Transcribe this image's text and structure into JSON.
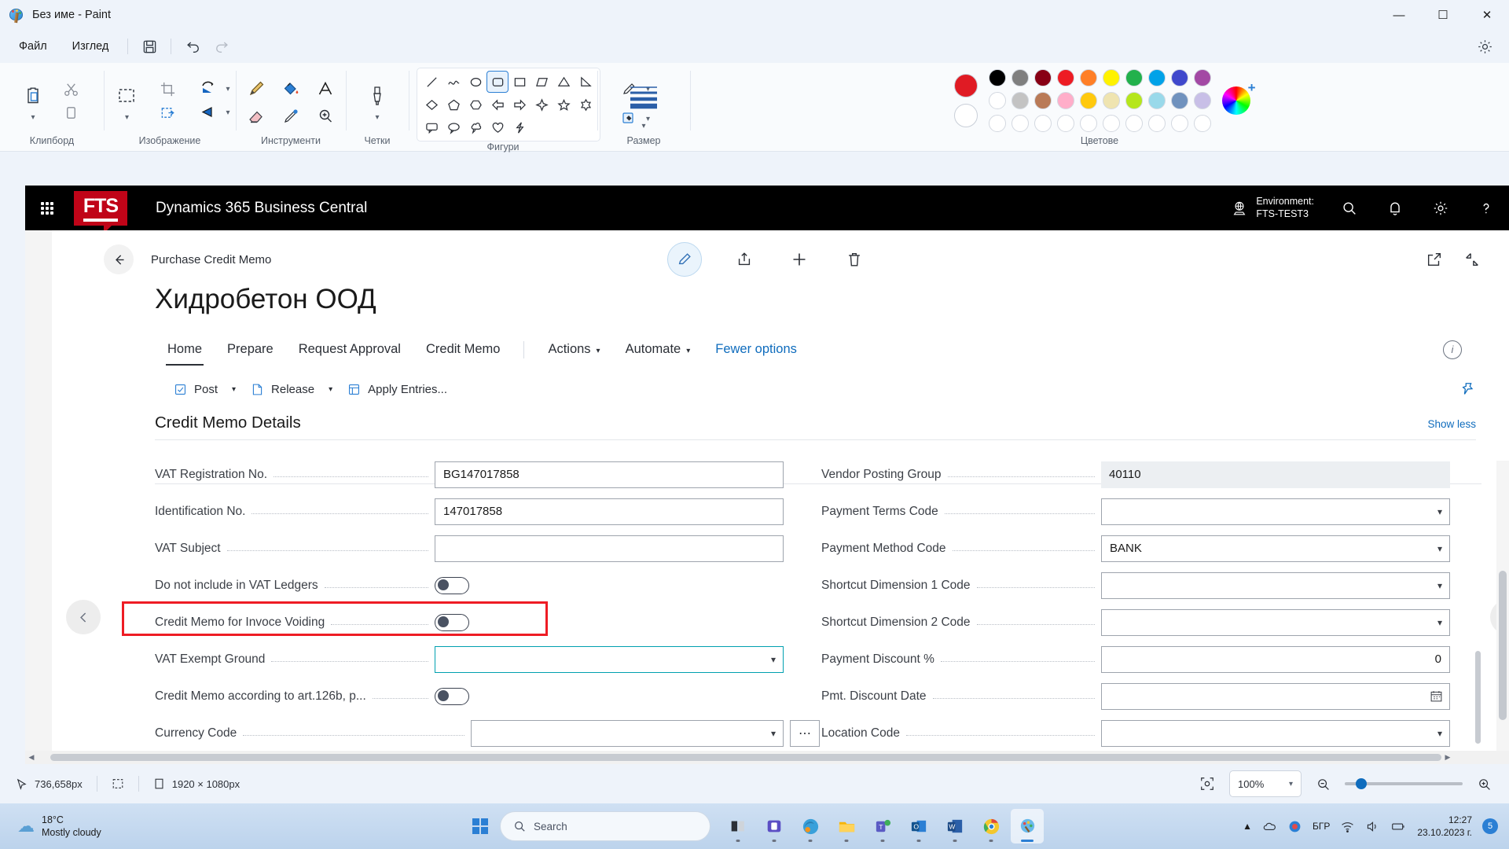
{
  "paint": {
    "title": "Без име - Paint",
    "menus": [
      "Файл",
      "Изглед"
    ],
    "groups": [
      {
        "label": "Клипборд"
      },
      {
        "label": "Изображение"
      },
      {
        "label": "Инструменти"
      },
      {
        "label": "Четки"
      },
      {
        "label": "Фигури"
      },
      {
        "label": "Размер"
      },
      {
        "label": "Цветове"
      }
    ],
    "icons": {
      "save": "save-icon",
      "undo": "undo-icon",
      "redo": "redo-icon",
      "settings": "settings-gear-icon",
      "paste": "paste-icon",
      "cut": "scissors-icon",
      "copy": "copy-icon",
      "select": "rectangular-select-icon",
      "crop": "crop-icon",
      "resize": "resize-image-icon",
      "rotate": "rotate-icon",
      "flip": "flip-icon",
      "pencil": "pencil-icon",
      "fill": "paint-bucket-icon",
      "text": "text-tool-icon",
      "eraser": "eraser-icon",
      "picker": "color-picker-icon",
      "magnifier": "magnifier-icon",
      "brush": "brush-icon",
      "outline": "shape-outline-icon",
      "shapefill": "shape-fill-icon",
      "size": "line-thickness-icon"
    },
    "colors": {
      "primary": "#e01b24",
      "secondary": "#ffffff",
      "row1": [
        "#000000",
        "#7f7f7f",
        "#880015",
        "#ed1c24",
        "#ff7f27",
        "#fff200",
        "#22b14c",
        "#00a2e8",
        "#3f48cc",
        "#a349a4"
      ],
      "row2": [
        "#ffffff",
        "#c3c3c3",
        "#b97a57",
        "#ffaec9",
        "#ffc90e",
        "#efe4b0",
        "#b5e61d",
        "#99d9ea",
        "#7092be",
        "#c8bfe7"
      ],
      "row3": [
        "#ffffff",
        "#ffffff",
        "#ffffff",
        "#ffffff",
        "#ffffff",
        "#ffffff",
        "#ffffff",
        "#ffffff",
        "#ffffff",
        "#ffffff"
      ]
    },
    "status": {
      "cursor_pos": "736,658px",
      "selection_icon": "selection-size-icon",
      "canvas_size": "1920 × 1080px",
      "zoom_value": "100%",
      "fit_icon": "fit-to-window-icon"
    }
  },
  "bc": {
    "app_title": "Dynamics 365 Business Central",
    "logo_text": "FTS",
    "environment_label": "Environment:",
    "environment_name": "FTS-TEST3",
    "topbar_icons": [
      "globe-icon",
      "search-icon",
      "notification-bell-icon",
      "settings-gear-icon",
      "help-question-icon"
    ],
    "breadcrumb": "Purchase Credit Memo",
    "page_title": "Хидробетон ООД",
    "command_icons": [
      "edit-pencil-icon",
      "share-icon",
      "add-plus-icon",
      "delete-trash-icon"
    ],
    "command_right_icons": [
      "open-in-new-window-icon",
      "collapse-icon"
    ],
    "tabs": [
      {
        "label": "Home",
        "type": "tab",
        "active": true
      },
      {
        "label": "Prepare",
        "type": "tab",
        "active": false
      },
      {
        "label": "Request Approval",
        "type": "tab",
        "active": false
      },
      {
        "label": "Credit Memo",
        "type": "tab",
        "active": false
      },
      {
        "label": "Actions",
        "type": "dropdown",
        "active": false
      },
      {
        "label": "Automate",
        "type": "dropdown",
        "active": false
      },
      {
        "label": "Fewer options",
        "type": "link",
        "active": false
      }
    ],
    "toolbar": [
      {
        "label": "Post",
        "icon": "post-icon",
        "has_chevron": true
      },
      {
        "label": "Release",
        "icon": "release-icon",
        "has_chevron": true
      },
      {
        "label": "Apply Entries...",
        "icon": "apply-entries-icon",
        "has_chevron": false
      }
    ],
    "toolbar_pin_icon": "pin-icon",
    "section": {
      "title": "Credit Memo Details",
      "show_less": "Show less"
    },
    "left_fields": [
      {
        "label": "VAT Registration No.",
        "type": "text",
        "value": "BG147017858"
      },
      {
        "label": "Identification No.",
        "type": "text",
        "value": "147017858"
      },
      {
        "label": "VAT Subject",
        "type": "text",
        "value": ""
      },
      {
        "label": "Do not include in VAT Ledgers",
        "type": "toggle",
        "value": "off"
      },
      {
        "label": "Credit Memo for Invoce Voiding",
        "type": "toggle",
        "value": "off",
        "highlighted": true
      },
      {
        "label": "VAT Exempt Ground",
        "type": "dropdown",
        "value": "",
        "focused": true
      },
      {
        "label": "Credit Memo according to art.126b, p...",
        "type": "toggle",
        "value": "off"
      },
      {
        "label": "Currency Code",
        "type": "dropdown-ellipsis",
        "value": ""
      }
    ],
    "right_fields": [
      {
        "label": "Vendor Posting Group",
        "type": "readonly",
        "value": "40110"
      },
      {
        "label": "Payment Terms Code",
        "type": "dropdown",
        "value": ""
      },
      {
        "label": "Payment Method Code",
        "type": "dropdown",
        "value": "BANK"
      },
      {
        "label": "Shortcut Dimension 1 Code",
        "type": "dropdown",
        "value": ""
      },
      {
        "label": "Shortcut Dimension 2 Code",
        "type": "dropdown",
        "value": ""
      },
      {
        "label": "Payment Discount %",
        "type": "number",
        "value": "0"
      },
      {
        "label": "Pmt. Discount Date",
        "type": "date",
        "value": ""
      },
      {
        "label": "Location Code",
        "type": "dropdown",
        "value": ""
      }
    ],
    "info_icon": "info-icon",
    "nav_prev_icon": "previous-record-icon",
    "nav_next_icon": "next-record-icon"
  },
  "taskbar": {
    "weather_temp": "18°C",
    "weather_desc": "Mostly cloudy",
    "search_placeholder": "Search",
    "start_icon": "windows-start-icon",
    "apps": [
      {
        "name": "taskview-icon"
      },
      {
        "name": "app-purple-icon"
      },
      {
        "name": "edge-browser-icon"
      },
      {
        "name": "file-explorer-icon"
      },
      {
        "name": "microsoft-teams-icon"
      },
      {
        "name": "outlook-icon"
      },
      {
        "name": "word-icon"
      },
      {
        "name": "chrome-icon"
      },
      {
        "name": "paint-icon"
      }
    ],
    "language": "БГР",
    "tray_icons": [
      "chevron-up-icon",
      "onedrive-icon",
      "antivirus-icon",
      "wifi-icon",
      "volume-icon",
      "battery-icon"
    ],
    "time": "12:27",
    "date": "23.10.2023 г.",
    "notification_count": "5"
  }
}
